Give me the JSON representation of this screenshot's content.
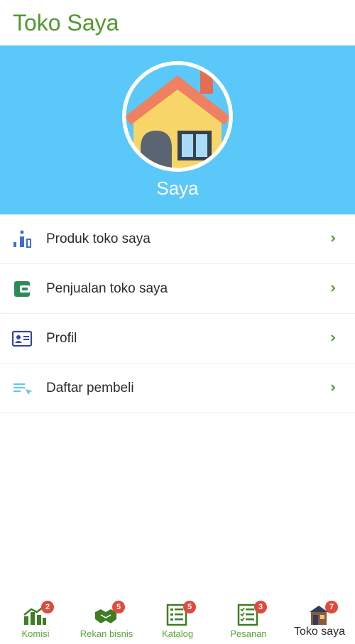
{
  "header": {
    "title": "Toko Saya"
  },
  "banner": {
    "name": "Saya",
    "background": "#5ac8f8"
  },
  "menu": {
    "items": [
      {
        "label": "Produk toko saya",
        "icon": "bar-chart-icon"
      },
      {
        "label": "Penjualan toko saya",
        "icon": "wallet-icon"
      },
      {
        "label": "Profil",
        "icon": "id-card-icon"
      },
      {
        "label": "Daftar pembeli",
        "icon": "list-icon"
      }
    ]
  },
  "bottom_nav": {
    "items": [
      {
        "label": "Komisi",
        "badge": "2",
        "icon": "commission-icon"
      },
      {
        "label": "Rekan bisnis",
        "badge": "5",
        "icon": "handshake-icon"
      },
      {
        "label": "Katalog",
        "badge": "5",
        "icon": "catalog-icon"
      },
      {
        "label": "Pesanan",
        "badge": "3",
        "icon": "orders-icon"
      },
      {
        "label": "Toko saya",
        "badge": "7",
        "icon": "store-icon",
        "active": true
      }
    ]
  },
  "colors": {
    "brand_green": "#4f9a2f",
    "badge_red": "#e4483c",
    "banner_blue": "#5ac8f8"
  }
}
